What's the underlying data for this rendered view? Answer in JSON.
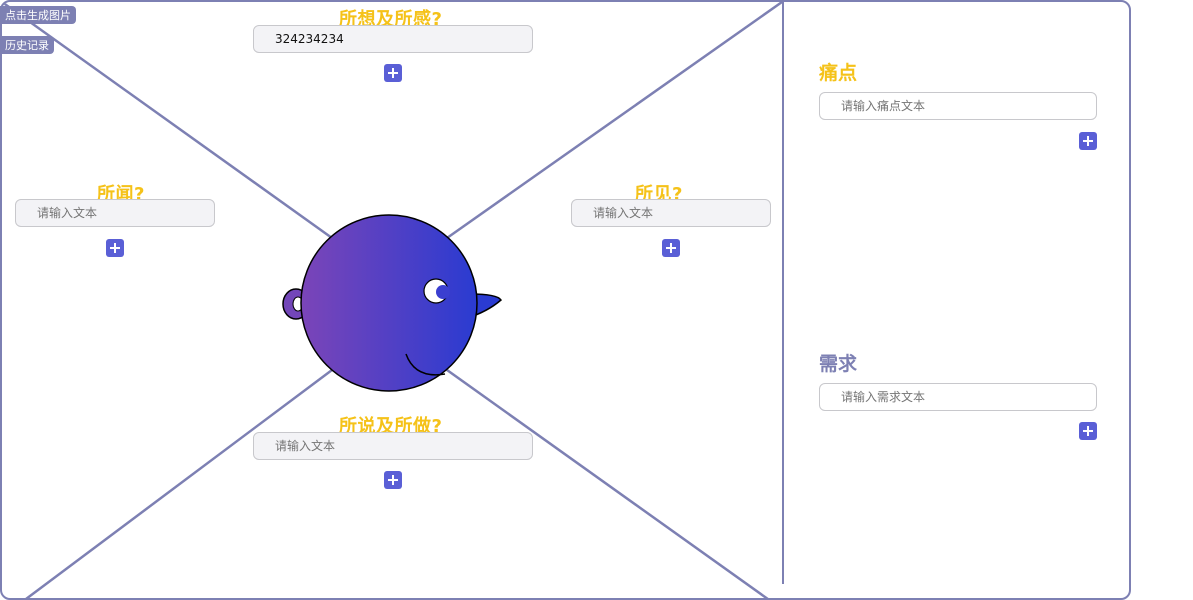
{
  "toolbar": {
    "generate_label": "点击生成图片",
    "history_label": "历史记录"
  },
  "quadrants": {
    "think": {
      "title": "所想及所感?",
      "value": "324234234",
      "placeholder": "请输入文本"
    },
    "hear": {
      "title": "所闻?",
      "value": "",
      "placeholder": "请输入文本"
    },
    "see": {
      "title": "所见?",
      "value": "",
      "placeholder": "请输入文本"
    },
    "say": {
      "title": "所说及所做?",
      "value": "",
      "placeholder": "请输入文本"
    }
  },
  "pain": {
    "title": "痛点",
    "value": "",
    "placeholder": "请输入痛点文本"
  },
  "need": {
    "title": "需求",
    "value": "",
    "placeholder": "请输入需求文本"
  },
  "colors": {
    "accent_title": "#f5c219",
    "need_title": "#7d80b3",
    "border": "#7d80b3",
    "add_button": "#5a5fd6",
    "head_gradient": [
      "#7b45b8",
      "#2a3bd1"
    ]
  },
  "icons": {
    "add": "plus-icon"
  }
}
